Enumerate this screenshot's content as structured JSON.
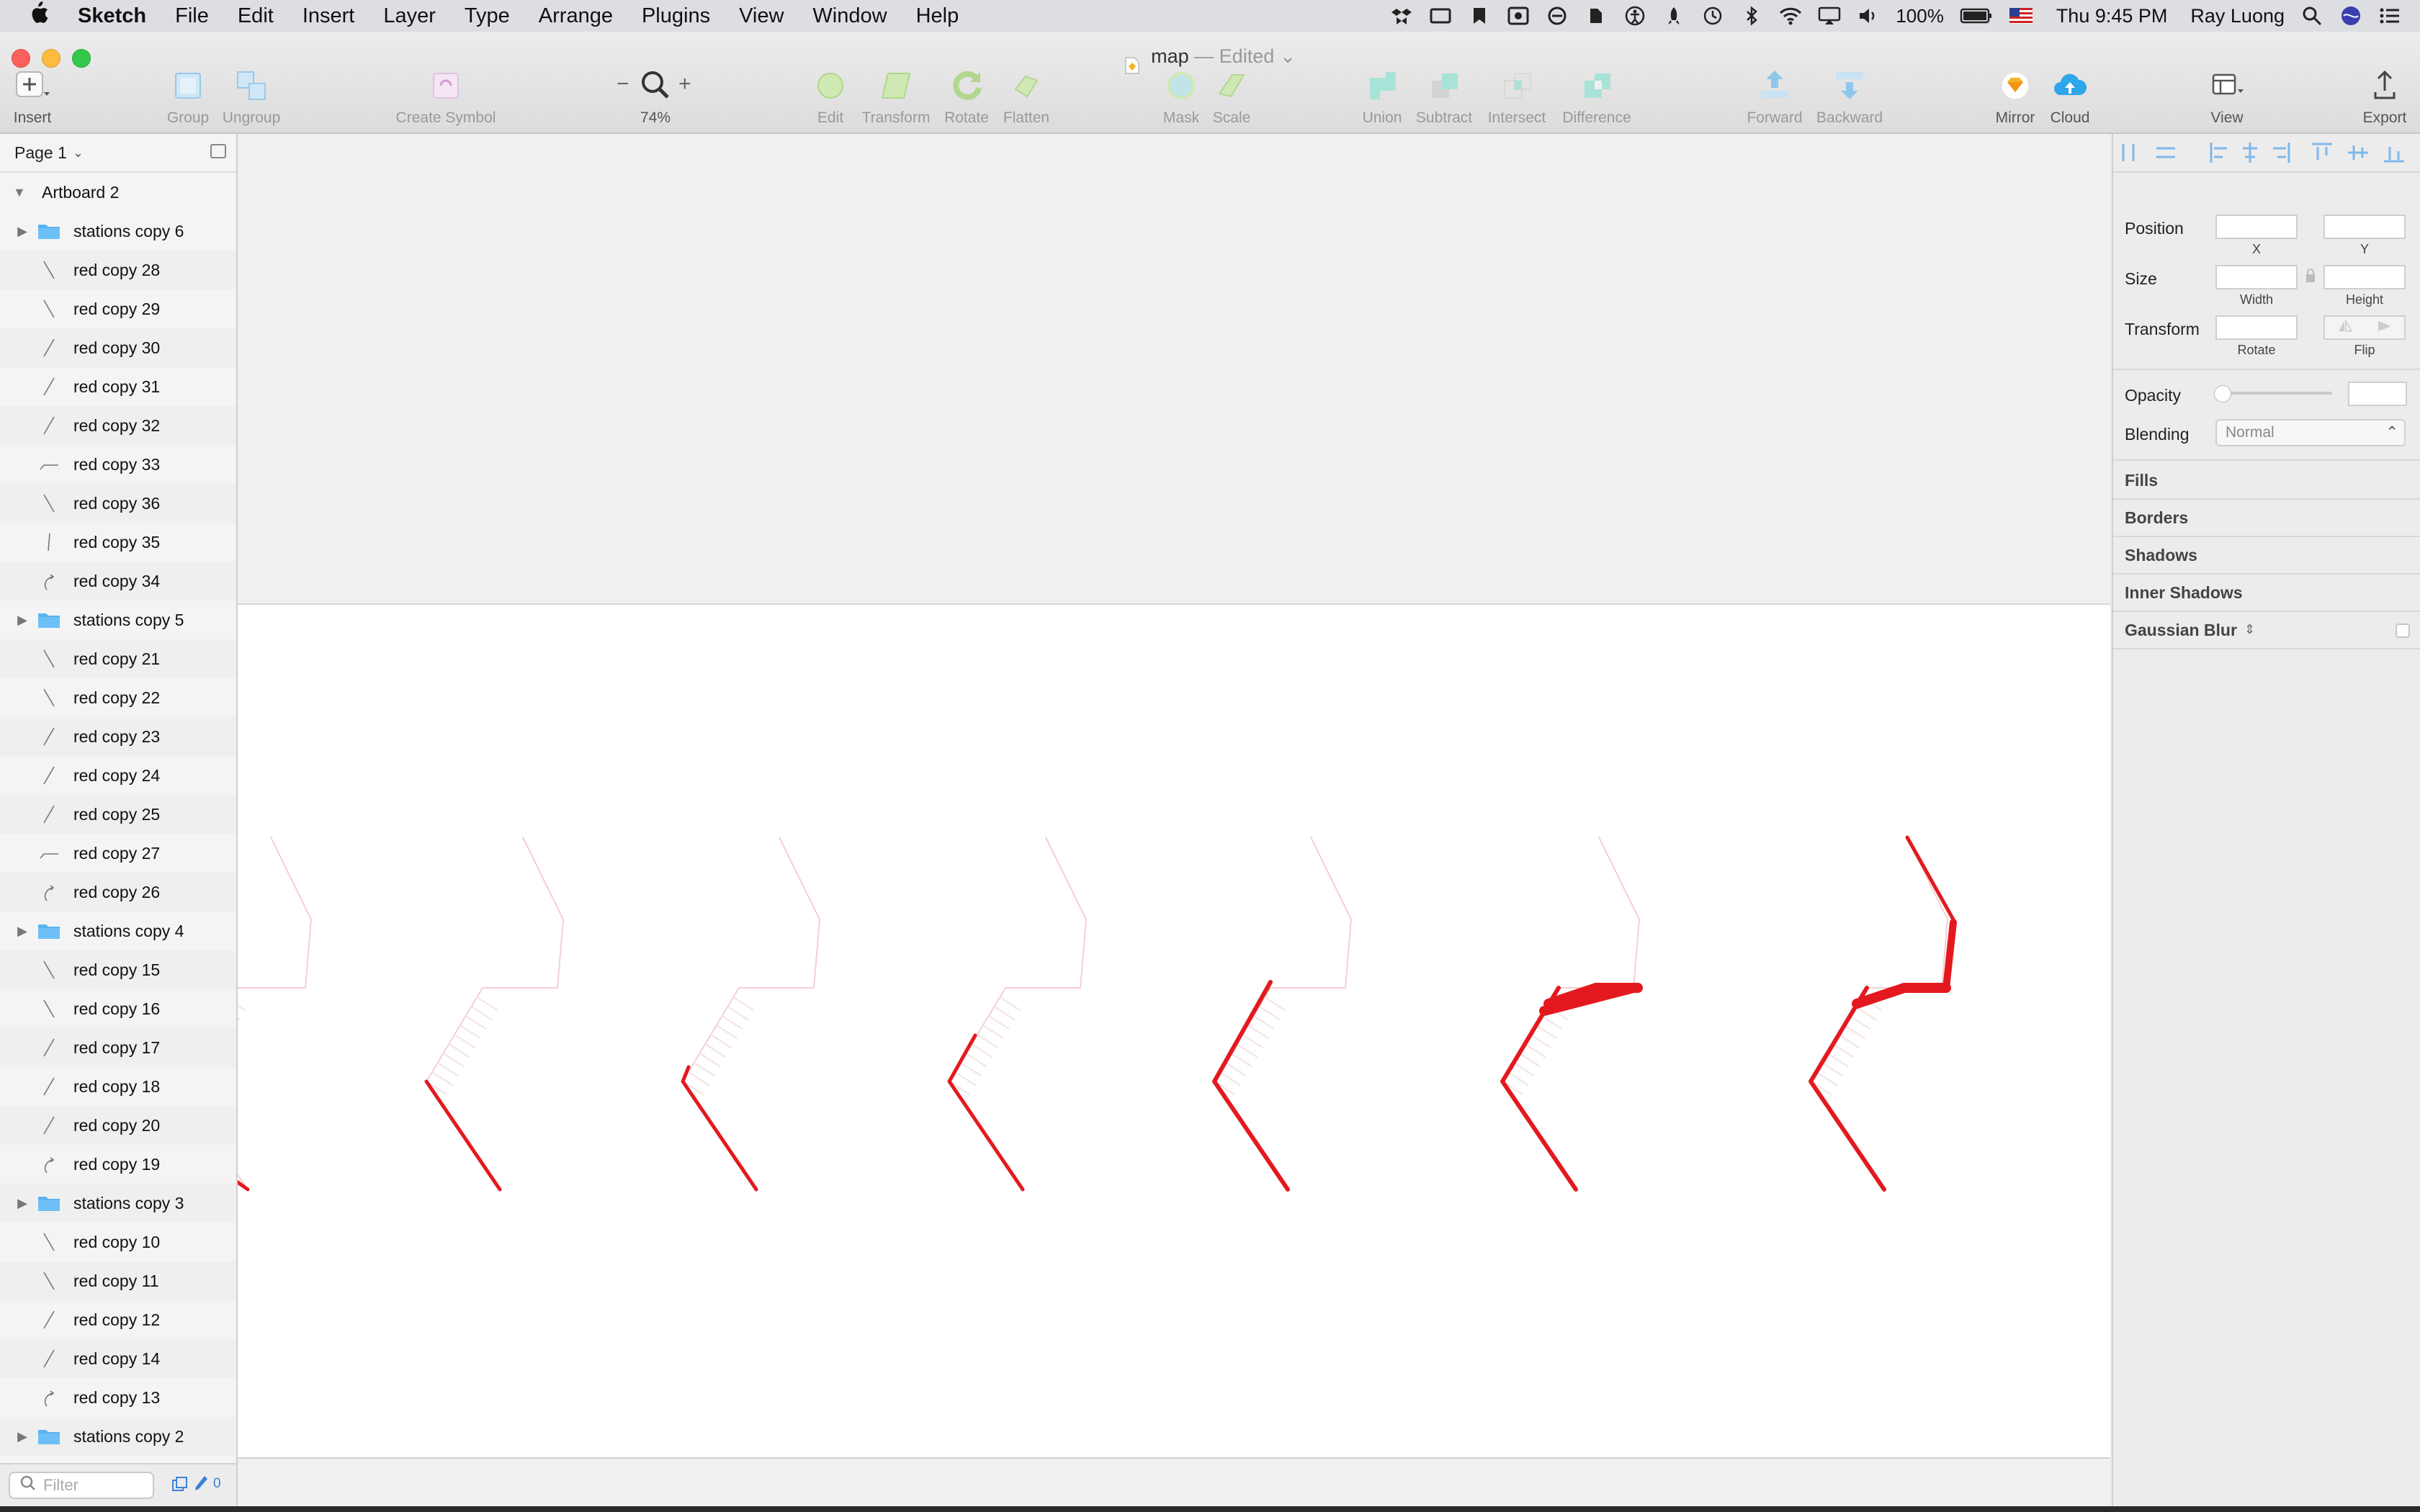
{
  "menubar": {
    "app_name": "Sketch",
    "menus": [
      "File",
      "Edit",
      "Insert",
      "Layer",
      "Type",
      "Arrange",
      "Plugins",
      "View",
      "Window",
      "Help"
    ],
    "battery": "100%",
    "clock": "Thu 9:45 PM",
    "user": "Ray Luong"
  },
  "window": {
    "document_name": "map",
    "edited_label": "— Edited"
  },
  "toolbar": {
    "insert": "Insert",
    "group": "Group",
    "ungroup": "Ungroup",
    "create_symbol": "Create Symbol",
    "zoom_level": "74%",
    "zoom_out": "−",
    "zoom_in": "+",
    "edit": "Edit",
    "transform": "Transform",
    "rotate": "Rotate",
    "flatten": "Flatten",
    "mask": "Mask",
    "scale": "Scale",
    "union": "Union",
    "subtract": "Subtract",
    "intersect": "Intersect",
    "difference": "Difference",
    "forward": "Forward",
    "backward": "Backward",
    "mirror": "Mirror",
    "cloud": "Cloud",
    "view": "View",
    "export": "Export"
  },
  "layers": {
    "page": "Page 1",
    "artboard": "Artboard 2",
    "items": [
      {
        "name": "stations copy 6",
        "kind": "folder"
      },
      {
        "name": "red copy 28",
        "kind": "line-back"
      },
      {
        "name": "red copy 29",
        "kind": "line-back"
      },
      {
        "name": "red copy 30",
        "kind": "line-fwd"
      },
      {
        "name": "red copy 31",
        "kind": "line-fwd"
      },
      {
        "name": "red copy 32",
        "kind": "line-fwd"
      },
      {
        "name": "red copy 33",
        "kind": "line-corner"
      },
      {
        "name": "red copy 36",
        "kind": "line-back"
      },
      {
        "name": "red copy 35",
        "kind": "line-vert"
      },
      {
        "name": "red copy 34",
        "kind": "line-curve"
      },
      {
        "name": "stations copy 5",
        "kind": "folder"
      },
      {
        "name": "red copy 21",
        "kind": "line-back"
      },
      {
        "name": "red copy 22",
        "kind": "line-back"
      },
      {
        "name": "red copy 23",
        "kind": "line-fwd"
      },
      {
        "name": "red copy 24",
        "kind": "line-fwd"
      },
      {
        "name": "red copy 25",
        "kind": "line-fwd"
      },
      {
        "name": "red copy 27",
        "kind": "line-corner"
      },
      {
        "name": "red copy 26",
        "kind": "line-curve"
      },
      {
        "name": "stations copy 4",
        "kind": "folder"
      },
      {
        "name": "red copy 15",
        "kind": "line-back"
      },
      {
        "name": "red copy 16",
        "kind": "line-back"
      },
      {
        "name": "red copy 17",
        "kind": "line-fwd"
      },
      {
        "name": "red copy 18",
        "kind": "line-fwd"
      },
      {
        "name": "red copy 20",
        "kind": "line-fwd"
      },
      {
        "name": "red copy 19",
        "kind": "line-curve"
      },
      {
        "name": "stations copy 3",
        "kind": "folder"
      },
      {
        "name": "red copy 10",
        "kind": "line-back"
      },
      {
        "name": "red copy 11",
        "kind": "line-back"
      },
      {
        "name": "red copy 12",
        "kind": "line-fwd"
      },
      {
        "name": "red copy 14",
        "kind": "line-fwd"
      },
      {
        "name": "red copy 13",
        "kind": "line-curve"
      },
      {
        "name": "stations copy 2",
        "kind": "folder"
      }
    ],
    "filter_placeholder": "Filter",
    "filter_count": "0"
  },
  "inspector": {
    "position": "Position",
    "x": "X",
    "y": "Y",
    "size": "Size",
    "width": "Width",
    "height": "Height",
    "transform": "Transform",
    "rotate": "Rotate",
    "flip": "Flip",
    "opacity": "Opacity",
    "blending": "Blending",
    "blending_value": "Normal",
    "sections": [
      "Fills",
      "Borders",
      "Shadows",
      "Inner Shadows",
      "Gaussian Blur"
    ]
  },
  "colors": {
    "route_red": "#e3191f",
    "route_faded": "#f6cfd2",
    "folder_blue": "#5ab3f0",
    "toolbar_teal": "#7fd8c8"
  }
}
